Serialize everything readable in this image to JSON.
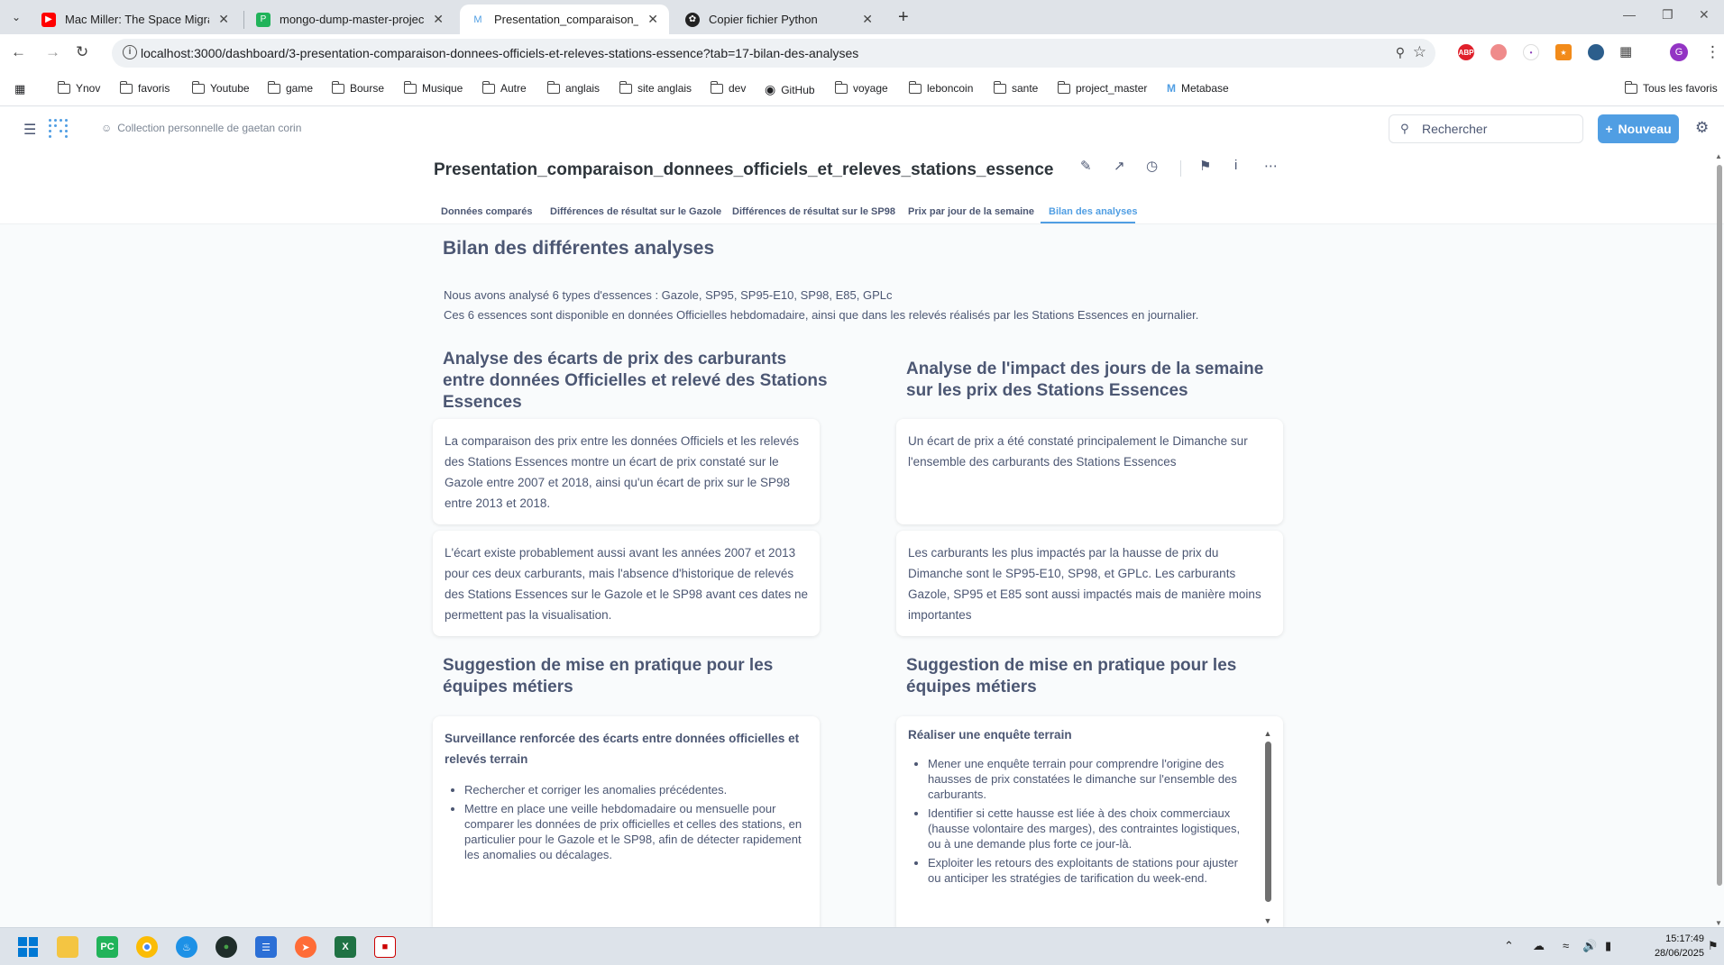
{
  "browser": {
    "tabs": [
      {
        "title": "Mac Miller: The Space Migratio",
        "favicon": "youtube-icon",
        "active": false
      },
      {
        "title": "mongo-dump-master-project -",
        "favicon": "pycharm-icon",
        "active": false
      },
      {
        "title": "Presentation_comparaison_don",
        "favicon": "metabase-icon",
        "active": true
      },
      {
        "title": "Copier fichier Python",
        "favicon": "openai-icon",
        "active": false
      }
    ],
    "url": "localhost:3000/dashboard/3-presentation-comparaison-donnees-officiels-et-releves-stations-essence?tab=17-bilan-des-analyses",
    "profile_initial": "G",
    "extensions": [
      "ABP",
      "",
      "",
      "",
      ""
    ],
    "bookmarks": [
      "Ynov",
      "favoris",
      "Youtube",
      "game",
      "Bourse",
      "Musique",
      "Autre",
      "anglais",
      "site anglais",
      "dev",
      "GitHub",
      "voyage",
      "leboncoin",
      "sante",
      "project_master",
      "Metabase"
    ],
    "bookmarks_right": "Tous les favoris"
  },
  "app": {
    "breadcrumb": "Collection personnelle de gaetan corin",
    "search_placeholder": "Rechercher",
    "new_button": "Nouveau",
    "accent_color": "#509ee3"
  },
  "dashboard": {
    "title": "Presentation_comparaison_donnees_officiels_et_releves_stations_essence",
    "tabs": [
      "Données comparés",
      "Différences de résultat sur le Gazole",
      "Différences de résultat sur le SP98",
      "Prix par jour de la semaine",
      "Bilan des analyses"
    ],
    "active_tab": "Bilan des analyses"
  },
  "content": {
    "heading": "Bilan des différentes analyses",
    "intro_line1": "Nous avons analysé 6 types d'essences : Gazole, SP95, SP95-E10, SP98, E85, GPLc",
    "intro_line2": "Ces 6 essences sont disponible en données Officielles hebdomadaire, ainsi que dans les relevés réalisés par les Stations Essences en journalier.",
    "left": {
      "heading": "Analyse des écarts de prix des carburants entre données Officielles et relevé des Stations Essences",
      "card1": "La comparaison des prix entre les données Officiels et les relevés des Stations Essences montre un écart de prix constaté sur le Gazole entre 2007 et 2018, ainsi qu'un écart de prix sur le SP98 entre 2013 et 2018.",
      "card2": "L'écart existe probablement aussi avant les années 2007 et 2013 pour ces deux carburants, mais l'absence d'historique de relevés des Stations Essences sur le Gazole et le SP98 avant ces dates ne permettent pas la visualisation.",
      "suggestion_heading": "Suggestion de mise en pratique pour les équipes métiers",
      "suggestion_title": "Surveillance renforcée des écarts entre données officielles et relevés terrain",
      "suggestion_items": [
        "Rechercher et corriger les anomalies précédentes.",
        "Mettre en place une veille hebdomadaire ou mensuelle pour comparer les données de prix officielles et celles des stations, en particulier pour le Gazole et le SP98, afin de détecter rapidement les anomalies ou décalages."
      ]
    },
    "right": {
      "heading": "Analyse de l'impact des jours de la semaine sur les prix des Stations Essences",
      "card1": "Un écart de prix a été constaté principalement le Dimanche sur l'ensemble des carburants des Stations Essences",
      "card2": "Les carburants les plus impactés par la hausse de prix du Dimanche sont le SP95-E10, SP98, et GPLc. Les carburants Gazole, SP95 et E85 sont aussi impactés mais de manière moins importantes",
      "suggestion_heading": "Suggestion de mise en pratique pour les équipes métiers",
      "suggestion_title": "Réaliser une enquête terrain",
      "suggestion_items": [
        "Mener une enquête terrain pour comprendre l'origine des hausses de prix constatées le dimanche sur l'ensemble des carburants.",
        "Identifier si cette hausse est liée à des choix commerciaux (hausse volontaire des marges), des contraintes logistiques, ou à une demande plus forte ce jour-là.",
        "Exploiter les retours des exploitants de stations pour ajuster ou anticiper les stratégies de tarification du week-end."
      ]
    }
  },
  "taskbar": {
    "time": "15:17:49",
    "date": "28/06/2025"
  }
}
